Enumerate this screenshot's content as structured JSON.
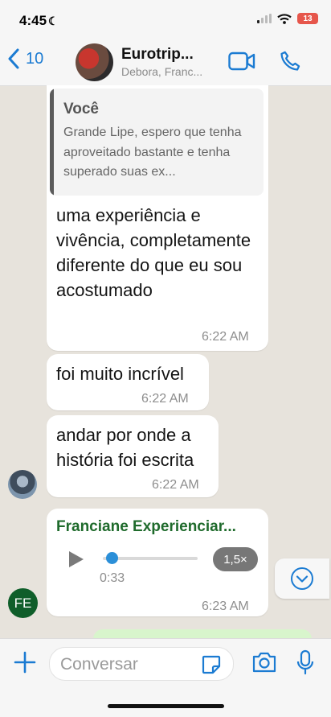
{
  "status_bar": {
    "time": "4:45",
    "battery": "13"
  },
  "header": {
    "back_count": "10",
    "title": "Eurotrip...",
    "subtitle": "Debora, Franc..."
  },
  "messages": [
    {
      "quote": {
        "author": "Você",
        "text": "Grande Lipe, espero que tenha aproveitado bastante e tenha superado suas ex..."
      },
      "text": "uma experiência e vivência, completamente diferente do que eu sou acostumado",
      "time": "6:22 AM"
    },
    {
      "text": "foi muito incrível",
      "time": "6:22 AM"
    },
    {
      "text": "andar por onde a história foi escrita",
      "time": "6:22 AM"
    }
  ],
  "voice_message": {
    "sender": "Franciane Experienciar...",
    "sender_initials": "FE",
    "duration": "0:33",
    "progress": 0.1,
    "speed": "1,5×",
    "time": "6:23 AM"
  },
  "composer": {
    "placeholder": "Conversar"
  },
  "colors": {
    "accent": "#1b7bd2",
    "sender_name": "#1f6b2c",
    "wallpaper": "#e7e3dc"
  }
}
